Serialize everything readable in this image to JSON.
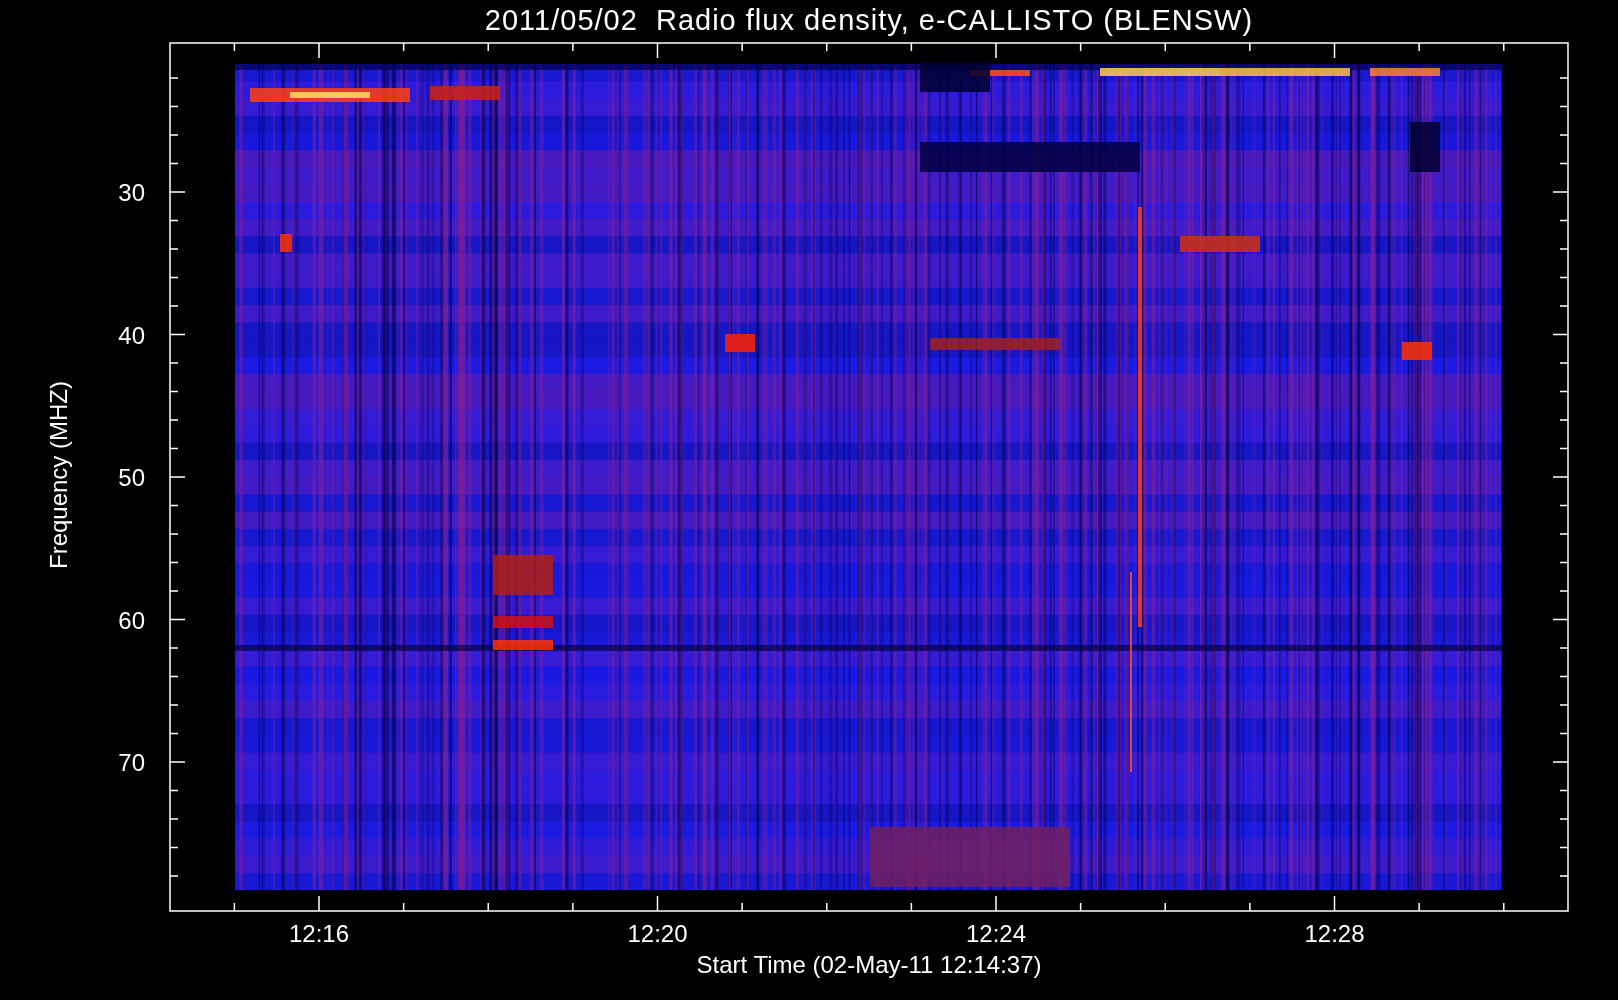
{
  "plot": {
    "title": "2011/05/02  Radio flux density, e-CALLISTO (BLENSW)",
    "y_axis": {
      "label": "Frequency (MHZ)",
      "ticks": [
        "30",
        "40",
        "50",
        "60",
        "70"
      ]
    },
    "x_axis": {
      "label": "Start Time (02-May-11 12:14:37)",
      "ticks": [
        "12:16",
        "12:20",
        "12:24",
        "12:28"
      ]
    }
  }
}
